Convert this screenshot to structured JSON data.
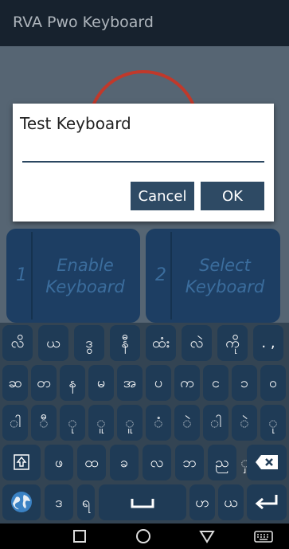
{
  "app": {
    "title": "RVA Pwo Keyboard"
  },
  "buttons": [
    {
      "number": "1",
      "label": "Enable Keyboard"
    },
    {
      "number": "2",
      "label": "Select Keyboard"
    }
  ],
  "dialog": {
    "title": "Test Keyboard",
    "input_value": "",
    "cancel_label": "Cancel",
    "ok_label": "OK"
  },
  "keyboard": {
    "rows": [
      [
        "လိ",
        "ယ",
        "ဒွ",
        "နီ",
        "ထံး",
        "လဲ",
        "ကို",
        ". ,"
      ],
      [
        "ဆ",
        "တ",
        "န",
        "မ",
        "အ",
        "ပ",
        "က",
        "င",
        "ၥ",
        "ဝ"
      ],
      [
        "ါ",
        "ီ",
        "ု",
        "ူ",
        "ူ",
        "ံ",
        "ဲ",
        "ါ",
        "ဲ",
        "ု"
      ],
      [
        "ဖ",
        "ထ",
        "ခ",
        "လ",
        "ဘ",
        "ည",
        "ှ"
      ],
      [
        "ဒ",
        "ရ",
        "ဟ",
        "ယ"
      ]
    ],
    "icons": {
      "shift": "shift-icon",
      "backspace": "backspace-icon",
      "globe": "globe-icon",
      "space": "space-icon",
      "enter": "enter-icon"
    }
  },
  "colors": {
    "appbar": "#17222e",
    "content": "#566573",
    "button": "#1d3e63",
    "dialog_button": "#2e4a64",
    "keyboard_bg": "#334453",
    "key": "#1f3b56",
    "accent_ring": "#c0392b"
  }
}
